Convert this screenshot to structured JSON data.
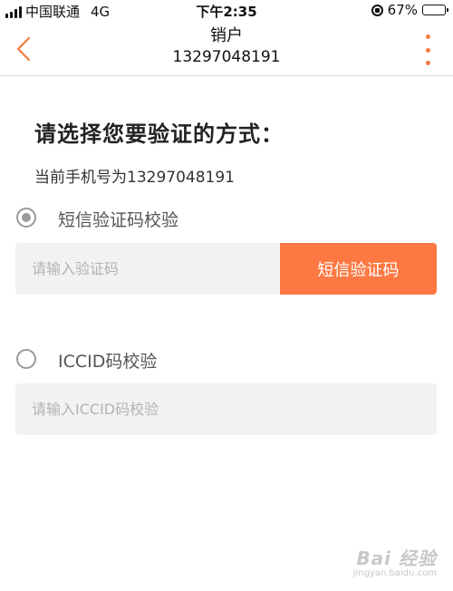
{
  "status_bar": {
    "carrier": "中国联通",
    "network": "4G",
    "time": "下午2:35",
    "battery_percent_text": "67%",
    "battery_level": 0.67
  },
  "nav": {
    "title": "销户",
    "subtitle": "13297048191",
    "accent_color": "#f47a40"
  },
  "content": {
    "heading": "请选择您要验证的方式：",
    "phone_line": "当前手机号为13297048191",
    "options": [
      {
        "label": "短信验证码校验",
        "selected": true,
        "input_placeholder": "请输入验证码",
        "action_label": "短信验证码"
      },
      {
        "label": "ICCID码校验",
        "selected": false,
        "input_placeholder": "请输入ICCID码校验"
      }
    ]
  },
  "watermark": {
    "top": "Bai 经验",
    "bottom": "jingyan.baidu.com"
  },
  "colors": {
    "button_orange": "#fd7843",
    "input_bg": "#f2f2f2"
  }
}
